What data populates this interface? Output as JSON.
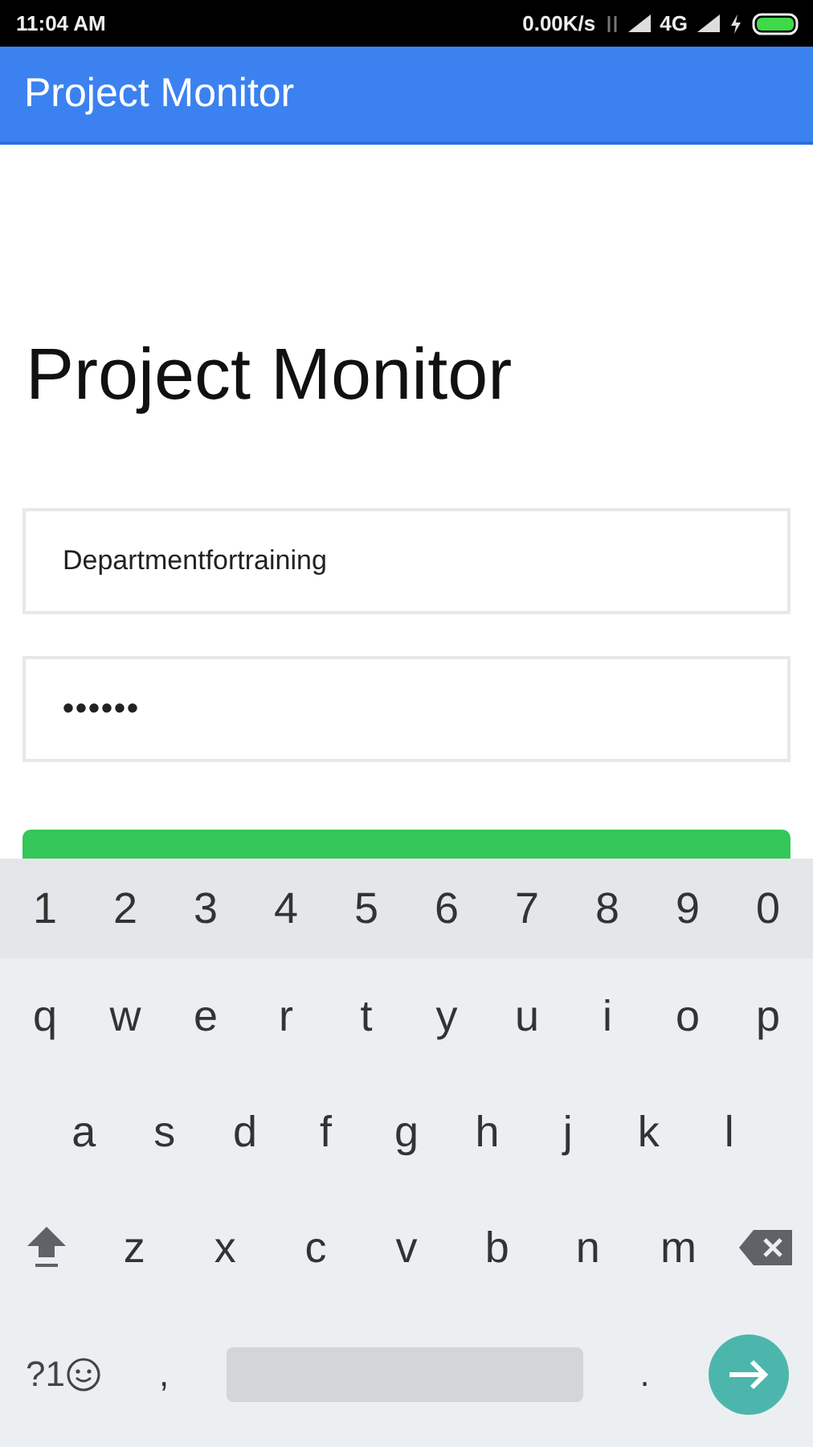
{
  "status_bar": {
    "time": "11:04 AM",
    "speed": "0.00K/s",
    "network": "4G"
  },
  "app_bar": {
    "title": "Project Monitor"
  },
  "heading": "Project Monitor",
  "fields": [
    {
      "kind": "username",
      "value": "Departmentfortraining"
    },
    {
      "kind": "password",
      "value": "••••••"
    }
  ],
  "login_button": {
    "kind": "button"
  },
  "keyboard": {
    "number_keys": [
      "1",
      "2",
      "3",
      "4",
      "5",
      "6",
      "7",
      "8",
      "9",
      "0"
    ],
    "top_letter_keys": [
      "q",
      "w",
      "e",
      "r",
      "t",
      "y",
      "u",
      "i",
      "o",
      "p"
    ],
    "middle_letter_keys": [
      "a",
      "s",
      "d",
      "f",
      "g",
      "h",
      "j",
      "k",
      "l"
    ],
    "bottom_letter_keys": [
      "z",
      "x",
      "c",
      "v",
      "b",
      "n",
      "m"
    ],
    "symbols_key": "?1",
    "comma": ",",
    "period": "."
  }
}
